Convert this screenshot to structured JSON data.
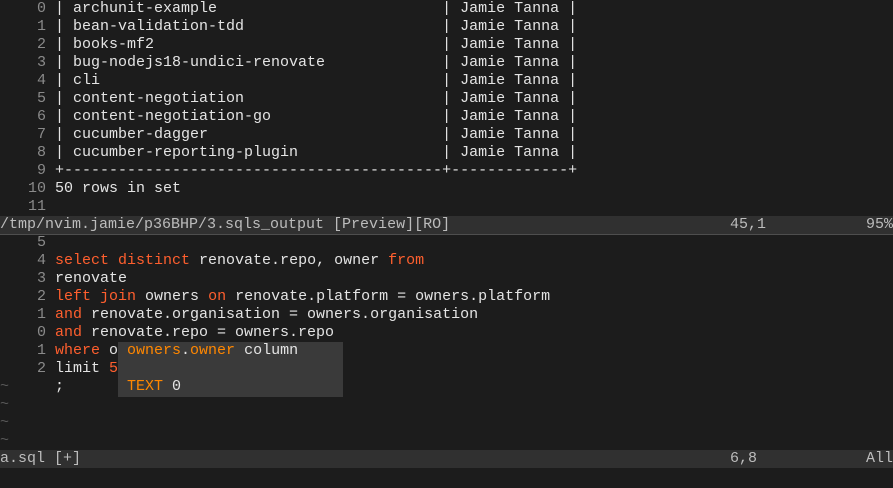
{
  "preview": {
    "rows": [
      {
        "num": "0",
        "text": "| archunit-example                         | Jamie Tanna |"
      },
      {
        "num": "1",
        "text": "| bean-validation-tdd                      | Jamie Tanna |"
      },
      {
        "num": "2",
        "text": "| books-mf2                                | Jamie Tanna |"
      },
      {
        "num": "3",
        "text": "| bug-nodejs18-undici-renovate             | Jamie Tanna |"
      },
      {
        "num": "4",
        "text": "| cli                                      | Jamie Tanna |"
      },
      {
        "num": "5",
        "text": "| content-negotiation                      | Jamie Tanna |"
      },
      {
        "num": "6",
        "text": "| content-negotiation-go                   | Jamie Tanna |"
      },
      {
        "num": "7",
        "text": "| cucumber-dagger                          | Jamie Tanna |"
      },
      {
        "num": "8",
        "text": "| cucumber-reporting-plugin                | Jamie Tanna |"
      },
      {
        "num": "9",
        "text": "+------------------------------------------+-------------+"
      },
      {
        "num": "10",
        "text": "50 rows in set"
      },
      {
        "num": "11",
        "text": ""
      }
    ],
    "status": {
      "name": "/tmp/nvim.jamie/p36BHP/3.sqls_output [Preview][RO]",
      "position": "45,1",
      "percent": "95%"
    }
  },
  "editor": {
    "line_numbers": [
      "5",
      "4",
      "3",
      "2",
      "1",
      "0",
      "1",
      "2"
    ],
    "l1": {
      "kw1": "select",
      "kw2": "distinct",
      "t1": " renovate.repo, owner ",
      "kw3": "from"
    },
    "l2": {
      "t1": "renovate"
    },
    "l3": {
      "kw1": "left",
      "kw2": "join",
      "t1": " owners ",
      "kw3": "on",
      "t2": " renovate.platform = owners.platform"
    },
    "l4": {
      "kw1": "and",
      "t1": " renovate.organisation = owners.organisation"
    },
    "l5": {
      "kw1": "and",
      "t1": " renovate.repo = owners.repo"
    },
    "l6": {
      "kw1": "where",
      "t1": " o",
      "cursor": "w",
      "t2": "ner ",
      "kw2": "is",
      "kw3": "not",
      "kw4": "null"
    },
    "l7": {
      "t1": "limit ",
      "num": "5"
    },
    "l8": {
      "t1": ";"
    },
    "tildes": [
      "~",
      "~",
      "~",
      "~"
    ],
    "status": {
      "name": "a.sql [+]",
      "position": "6,8",
      "percent": "All"
    }
  },
  "completion": {
    "item_a": "owners",
    "item_dot": ".",
    "item_b": "owner",
    "item_kind": "column",
    "detail_type": "TEXT",
    "detail_value": "0"
  }
}
